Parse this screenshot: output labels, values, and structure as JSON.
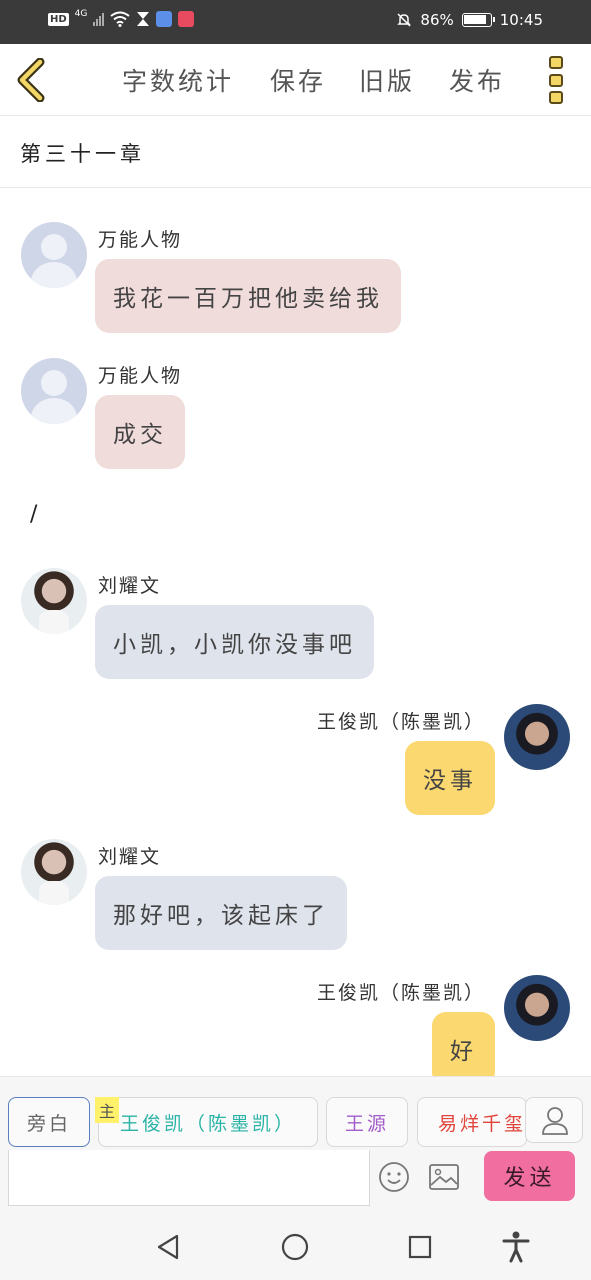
{
  "status_bar": {
    "hd": "HD",
    "network": "4G",
    "battery_percent": "86%",
    "time": "10:45",
    "icons": [
      "hd-icon",
      "signal-icon",
      "wifi-icon",
      "hourglass-icon",
      "music-app-icon",
      "book-app-icon",
      "mute-icon",
      "battery-icon"
    ]
  },
  "toolbar": {
    "word_count": "字数统计",
    "save": "保存",
    "old_version": "旧版",
    "publish": "发布"
  },
  "chapter": {
    "title": "第三十一章"
  },
  "messages": [
    {
      "speaker": "万能人物",
      "text": "我花一百万把他卖给我",
      "side": "left",
      "color": "#f1dcdc"
    },
    {
      "speaker": "万能人物",
      "text": "成交",
      "side": "left",
      "color": "#f1dcdc"
    },
    {
      "narration": "/"
    },
    {
      "speaker": "刘耀文",
      "text": "小凯，小凯你没事吧",
      "side": "left",
      "color": "#dfe3ec"
    },
    {
      "speaker": "王俊凯（陈墨凯）",
      "text": "没事",
      "side": "right",
      "color": "#fbd870"
    },
    {
      "speaker": "刘耀文",
      "text": "那好吧，该起床了",
      "side": "left",
      "color": "#dfe3ec"
    },
    {
      "speaker": "王俊凯（陈墨凯）",
      "text": "好",
      "side": "right",
      "color": "#fbd870"
    }
  ],
  "roles": {
    "main_tag": "主",
    "items": [
      {
        "label": "旁白",
        "color": "#666666"
      },
      {
        "label": "王俊凯（陈墨凯）",
        "color": "#2ab3a6"
      },
      {
        "label": "王源",
        "color": "#a25cc9"
      },
      {
        "label": "易烊千玺",
        "color": "#e0443a"
      }
    ]
  },
  "composer": {
    "input_value": "",
    "send": "发送"
  },
  "nav": {
    "icons": [
      "back-nav-icon",
      "home-nav-icon",
      "recents-nav-icon",
      "accessibility-icon"
    ]
  }
}
